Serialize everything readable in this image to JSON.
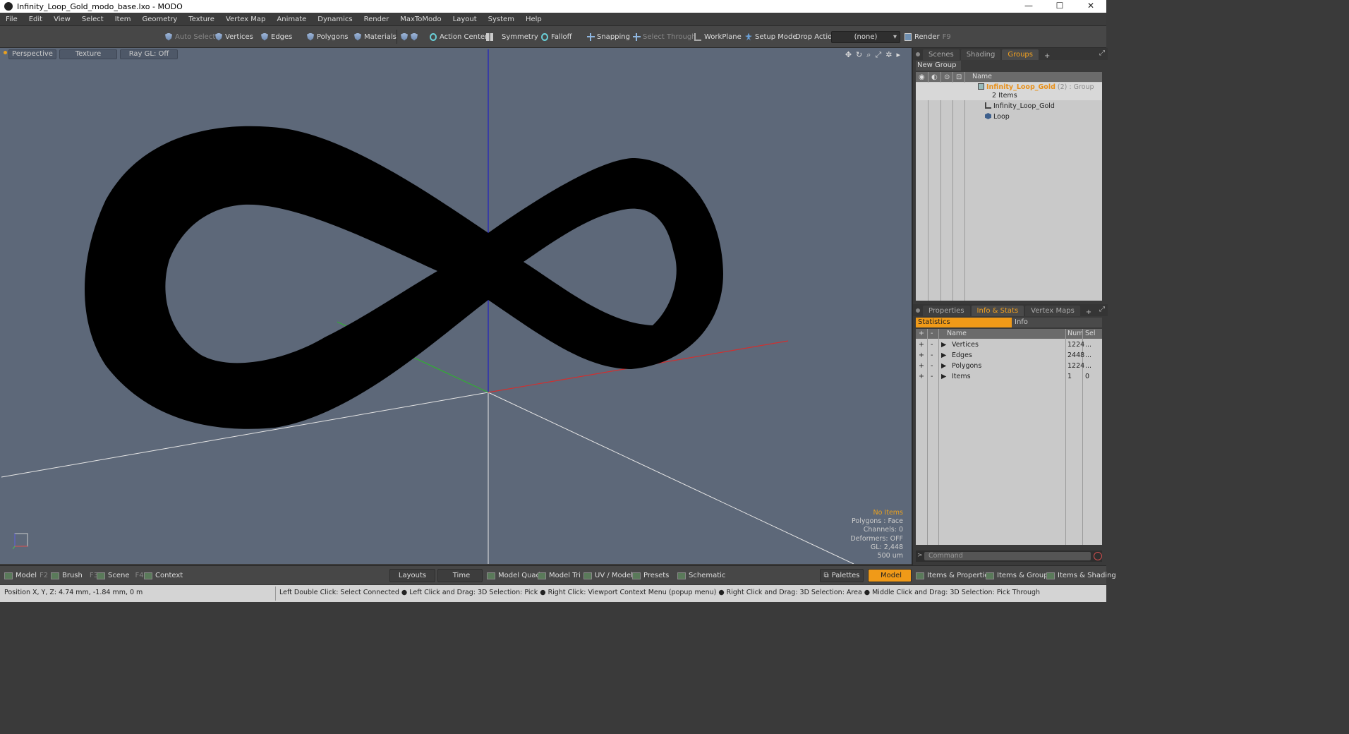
{
  "window": {
    "title": "Infinity_Loop_Gold_modo_base.lxo - MODO",
    "minimize": "—",
    "maximize": "☐",
    "close": "✕"
  },
  "menu": [
    "File",
    "Edit",
    "View",
    "Select",
    "Item",
    "Geometry",
    "Texture",
    "Vertex Map",
    "Animate",
    "Dynamics",
    "Render",
    "MaxToModo",
    "Layout",
    "System",
    "Help"
  ],
  "toolbar": {
    "auto_select": "Auto Select",
    "vertices": "Vertices",
    "edges": "Edges",
    "polygons": "Polygons",
    "materials": "Materials",
    "action_center": "Action Center",
    "symmetry": "Symmetry",
    "falloff": "Falloff",
    "snapping": "Snapping",
    "select_through": "Select Through",
    "workplane": "WorkPlane",
    "setup_mode": "Setup Mode",
    "drop_action": "Drop Action",
    "drop_action_value": "(none)",
    "render": "Render",
    "render_key": "F9"
  },
  "viewport": {
    "view_mode": "Perspective",
    "shading": "Texture",
    "raygl": "Ray GL: Off",
    "overlay": {
      "no_items": "No Items",
      "polygons": "Polygons : Face",
      "channels": "Channels: 0",
      "deformers": "Deformers: OFF",
      "gl": "GL: 2,448",
      "scale": "500 um"
    }
  },
  "scene_panel": {
    "tabs": [
      "Scenes",
      "Shading",
      "Groups"
    ],
    "active_tab": "Groups",
    "new_group": "New Group",
    "col_name": "Name",
    "group_name": "Infinity_Loop_Gold",
    "group_count": "(2)",
    "group_type": ": Group",
    "group_items": "2 Items",
    "children": [
      "Infinity_Loop_Gold",
      "Loop"
    ]
  },
  "info_panel": {
    "tabs": [
      "Properties",
      "Info & Stats",
      "Vertex Maps"
    ],
    "active_tab": "Info & Stats",
    "sub_statistics": "Statistics",
    "sub_info": "Info",
    "col_name": "Name",
    "col_num": "Num",
    "col_sel": "Sel",
    "rows": [
      {
        "name": "Vertices",
        "num": "1224",
        "sel": "..."
      },
      {
        "name": "Edges",
        "num": "2448",
        "sel": "..."
      },
      {
        "name": "Polygons",
        "num": "1224",
        "sel": "..."
      },
      {
        "name": "Items",
        "num": "1",
        "sel": "0"
      }
    ],
    "command_placeholder": "Command"
  },
  "bottom": {
    "model": "Model",
    "model_key": "F2",
    "brush": "Brush",
    "brush_key": "F3",
    "scene": "Scene",
    "scene_key": "F4",
    "context": "Context",
    "layouts": "Layouts",
    "time": "Time",
    "model_quad": "Model Quad",
    "model_tri": "Model Tri",
    "uv_model": "UV / Model",
    "presets": "Presets",
    "schematic": "Schematic",
    "palettes": "Palettes",
    "model_active": "Model",
    "items_properties": "Items & Properties",
    "items_groups": "Items & Groups",
    "items_shading": "Items & Shading"
  },
  "status": {
    "position": "Position X, Y, Z:   4.74 mm, -1.84 mm, 0 m",
    "hint": "Left Double Click: Select Connected ● Left Click and Drag: 3D Selection: Pick ● Right Click: Viewport Context Menu (popup menu) ● Right Click and Drag: 3D Selection: Area ● Middle Click and Drag: 3D Selection: Pick Through"
  },
  "colors": {
    "accent": "#f09a18",
    "viewport_bg": "#5d6879",
    "axis_x": "#d03030",
    "axis_y": "#2020c0",
    "axis_z": "#30b030"
  }
}
